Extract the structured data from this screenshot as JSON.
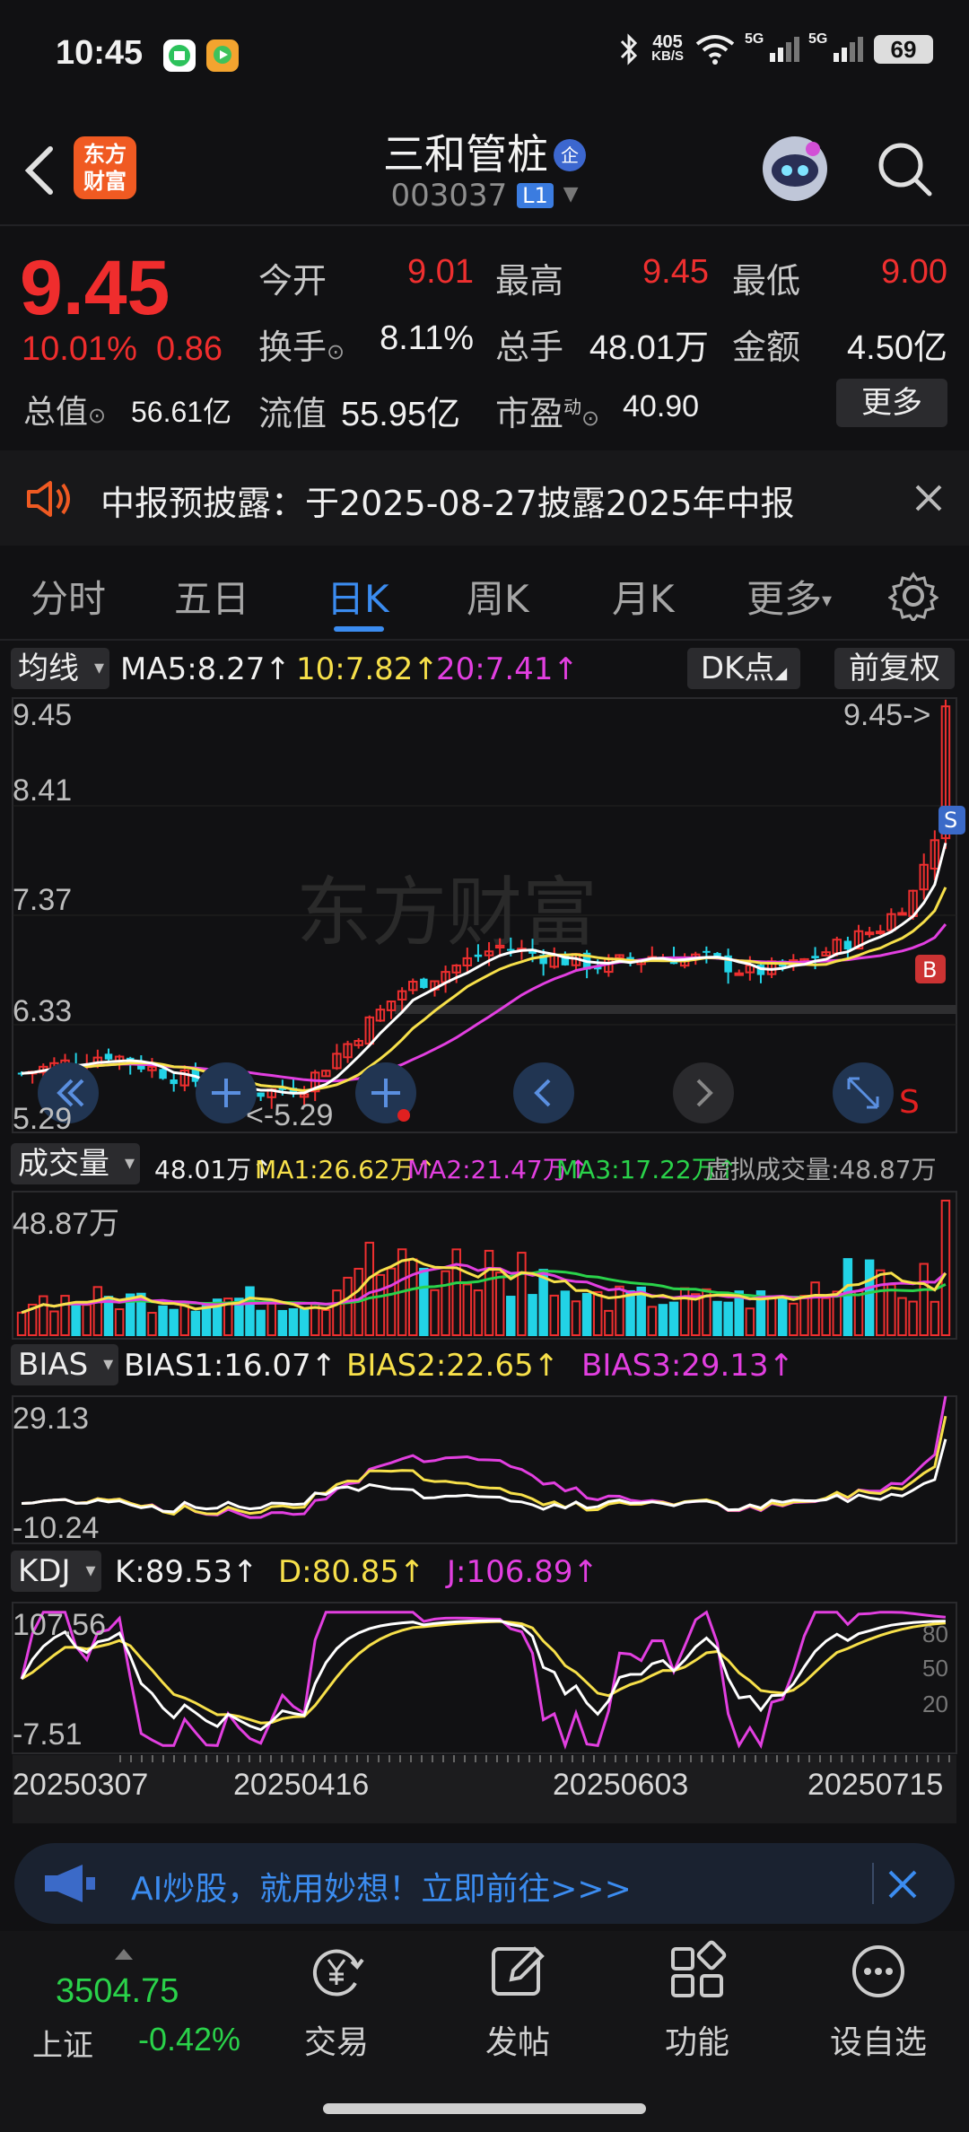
{
  "status_bar": {
    "time": "10:45",
    "net_speed_value": "405",
    "net_speed_unit": "KB/S",
    "net1": "5G",
    "net2": "5G",
    "battery": "69"
  },
  "header": {
    "logo_line1": "东方",
    "logo_line2": "财富",
    "title": "三和管桩",
    "badge": "企",
    "code": "003037",
    "market_level": "L1"
  },
  "quote": {
    "price": "9.45",
    "pct": "10.01%",
    "change": "0.86",
    "rows": [
      [
        {
          "label": "今开",
          "value": "9.01",
          "color": "red"
        },
        {
          "label": "最高",
          "value": "9.45",
          "color": "red"
        },
        {
          "label": "最低",
          "value": "9.00",
          "color": "red"
        }
      ],
      [
        {
          "label": "换手",
          "value": "8.11%",
          "color": "white"
        },
        {
          "label": "总手",
          "value": "48.01万",
          "color": "white"
        },
        {
          "label": "金额",
          "value": "4.50亿",
          "color": "white"
        }
      ]
    ],
    "row3": {
      "mv_label": "总值",
      "mv_value": "56.61亿",
      "fv_label": "流值",
      "fv_value": "55.95亿",
      "pe_label": "市盈",
      "pe_sup": "动",
      "pe_value": "40.90"
    },
    "more": "更多"
  },
  "notice": {
    "text": "中报预披露：于2025-08-27披露2025年中报"
  },
  "tabs": [
    "分时",
    "五日",
    "日K",
    "周K",
    "月K",
    "更多"
  ],
  "active_tab": "日K",
  "ma_row": {
    "btn": "均线",
    "ma5": "MA5:8.27↑",
    "ma10": "10:7.82↑",
    "ma20": "20:7.41↑",
    "dk": "DK点",
    "fq": "前复权"
  },
  "price_axis": [
    "9.45",
    "8.41",
    "7.37",
    "6.33",
    "5.29"
  ],
  "price_marks": {
    "high": "9.45->",
    "low": "<-5.29",
    "watermark": "东方财富",
    "sell": "S",
    "buy": "B",
    "sell_flag": "S"
  },
  "vol_row": {
    "btn": "成交量",
    "v": "48.01万↑",
    "ma1": "MA1:26.62万↑",
    "ma2": "MA2:21.47万↑",
    "ma3": "MA3:17.22万↑",
    "virtual": "虚拟成交量:48.87万",
    "axis_top": "48.87万"
  },
  "bias_row": {
    "btn": "BIAS",
    "b1": "BIAS1:16.07↑",
    "b2": "BIAS2:22.65↑",
    "b3": "BIAS3:29.13↑",
    "axis_top": "29.13",
    "axis_bottom": "-10.24"
  },
  "kdj_row": {
    "btn": "KDJ",
    "k": "K:89.53↑",
    "d": "D:80.85↑",
    "j": "J:106.89↑",
    "axis_top": "107.56",
    "axis_bottom": "-7.51",
    "levels": [
      "80",
      "50",
      "20"
    ]
  },
  "dates": [
    "20250307",
    "20250416",
    "20250603",
    "20250715"
  ],
  "ai_banner": {
    "text": "AI炒股，就用妙想！立即前往>>>"
  },
  "bottom_nav": {
    "index_value": "3504.75",
    "index_name": "上证",
    "index_change": "-0.42%",
    "items": [
      "交易",
      "发帖",
      "功能",
      "设自选"
    ]
  },
  "colors": {
    "up": "#ee2f2f",
    "down": "#22d3e6",
    "ma5": "#ffffff",
    "ma10": "#f7e04a",
    "ma20": "#e23fe0",
    "accent": "#3b8cf0"
  }
}
